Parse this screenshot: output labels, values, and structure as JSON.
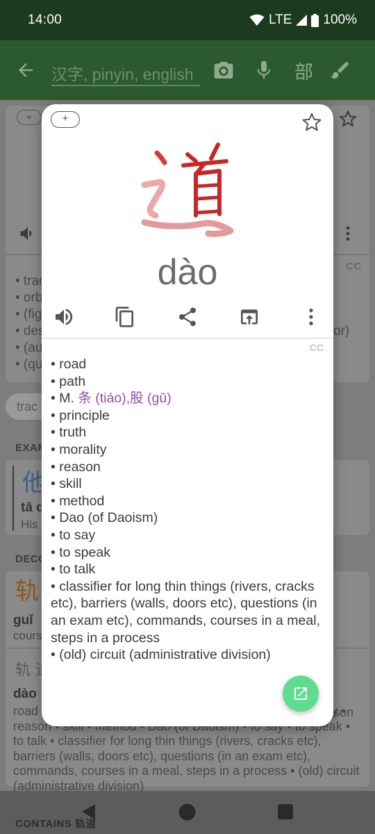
{
  "status_bar": {
    "time": "14:00",
    "network": "LTE",
    "battery": "100%"
  },
  "search": {
    "placeholder": "汉字, pinyin, english",
    "radical_button": "部"
  },
  "background": {
    "add_label": "+",
    "cc_label": "CC",
    "def_fragments": [
      "• trac",
      "• orb",
      "• (fig",
      "• des",
      "• (au",
      "• (qu"
    ],
    "def_right_fragment": "or)",
    "chip_label": "trac",
    "examples_label": "EXAM",
    "example_char": "他",
    "example_pinyin": "tā d",
    "example_trans": "His",
    "decomposition_label": "DECO",
    "decomp_char": "轨",
    "decomp_pinyin": "guǐ",
    "decomp_gloss": "cours",
    "compound_chars": "轨 道",
    "compound_pinyin": "dào",
    "compound_right": "son",
    "compound_para": "road • path • M. 条 (tiáo),股 (gǔ) • principle • truth • morality • reason • skill • method • Dao (of Daoism) • to say • to speak • to talk • classifier for long thin things (rivers, cracks etc), barriers (walls, doors etc), questions (in an exam etc), commands, courses in a meal, steps in a process • (old) circuit (administrative division)",
    "contains_label": "CONTAINS 轨道"
  },
  "dialog": {
    "add_label": "+",
    "character": "道",
    "pinyin": "dào",
    "cc_label": "CC",
    "definitions": [
      {
        "text": "road"
      },
      {
        "text": "path"
      },
      {
        "prefix": "M. ",
        "links": "条 (tiáo),股 (gǔ)"
      },
      {
        "text": "principle"
      },
      {
        "text": "truth"
      },
      {
        "text": "morality"
      },
      {
        "text": "reason"
      },
      {
        "text": "skill"
      },
      {
        "text": "method"
      },
      {
        "text": "Dao (of Daoism)"
      },
      {
        "text": "to say"
      },
      {
        "text": "to speak"
      },
      {
        "text": "to talk"
      },
      {
        "text": "classifier for long thin things (rivers, cracks etc), barriers (walls, doors etc), questions (in an exam etc), commands, courses in a meal, steps in a process"
      },
      {
        "text": "(old) circuit (administrative division)"
      }
    ]
  },
  "colors": {
    "accent": "#2b5a2e",
    "link": "#8e4ea7",
    "fab": "#5fdc8d",
    "stroke_red": "#c62828",
    "stroke_pink": "#e29a9a"
  },
  "icons": [
    "back-arrow-icon",
    "camera-icon",
    "mic-icon",
    "brush-icon",
    "star-icon",
    "speaker-icon",
    "copy-icon",
    "share-icon",
    "open-in-icon",
    "more-vert-icon",
    "open-external-icon"
  ]
}
